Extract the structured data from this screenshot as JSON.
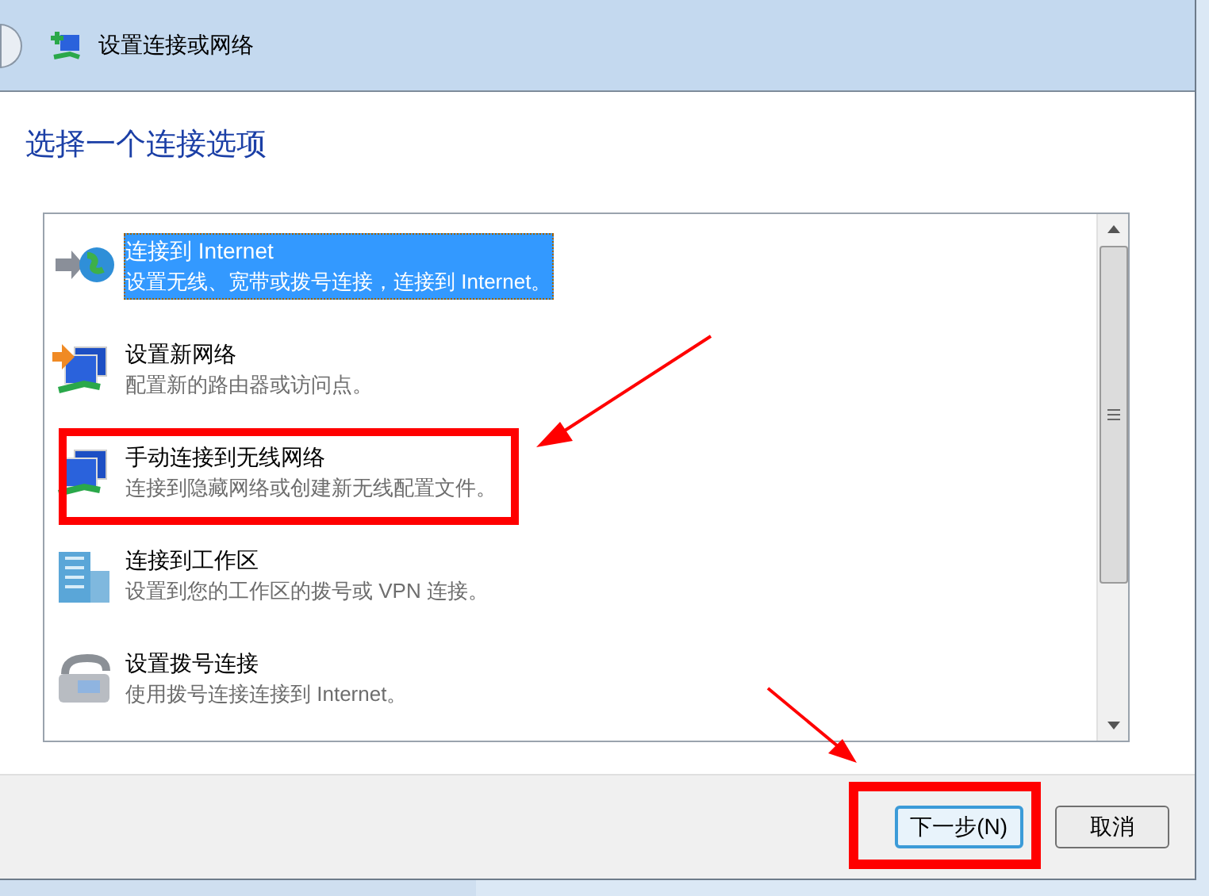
{
  "window": {
    "title": "设置连接或网络"
  },
  "heading": "选择一个连接选项",
  "options": [
    {
      "title": "连接到 Internet",
      "description": "设置无线、宽带或拨号连接，连接到 Internet。",
      "kind": "globe",
      "selected": true
    },
    {
      "title": "设置新网络",
      "description": "配置新的路由器或访问点。",
      "kind": "new-network",
      "selected": false
    },
    {
      "title": "手动连接到无线网络",
      "description": "连接到隐藏网络或创建新无线配置文件。",
      "kind": "network",
      "selected": false
    },
    {
      "title": "连接到工作区",
      "description": "设置到您的工作区的拨号或 VPN 连接。",
      "kind": "workplace",
      "selected": false
    },
    {
      "title": "设置拨号连接",
      "description": "使用拨号连接连接到 Internet。",
      "kind": "phone",
      "selected": false
    }
  ],
  "buttons": [
    {
      "label": "下一步(N)",
      "default": true
    },
    {
      "label": "取消",
      "default": false
    }
  ]
}
